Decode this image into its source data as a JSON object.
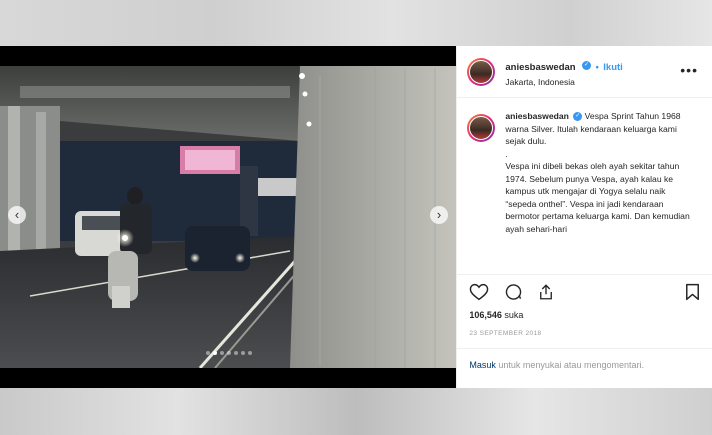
{
  "header": {
    "username": "aniesbaswedan",
    "separator": "•",
    "follow_label": "Ikuti",
    "location": "Jakarta, Indonesia",
    "more_label": "•••"
  },
  "caption": {
    "username": "aniesbaswedan",
    "line1": "Vespa Sprint Tahun 1968 warna Silver. Itulah kendaraan keluarga kami sejak dulu.",
    "line2": ".",
    "line3": "Vespa ini dibeli bekas oleh ayah sekitar tahun 1974. Sebelum punya Vespa, ayah kalau ke kampus utk mengajar di Yogya selalu naik “sepeda onthel”. Vespa ini jadi kendaraan bermotor pertama keluarga kami. Dan kemudian ayah sehari-hari"
  },
  "carousel": {
    "prev_label": "‹",
    "next_label": "›",
    "dot_count": 7,
    "active_dot": 1
  },
  "stats": {
    "likes_count": "106,546",
    "likes_label": "suka",
    "date": "23 SEPTEMBER 2018"
  },
  "login": {
    "link": "Masuk",
    "text": "untuk menyukai atau mengomentari."
  },
  "icons": {
    "like": "heart-icon",
    "comment": "comment-icon",
    "share": "share-icon",
    "save": "bookmark-icon",
    "verified": "verified-badge-icon"
  },
  "colors": {
    "link_blue": "#3897f0",
    "login_link": "#003569",
    "text": "#262626",
    "muted": "#999999"
  }
}
